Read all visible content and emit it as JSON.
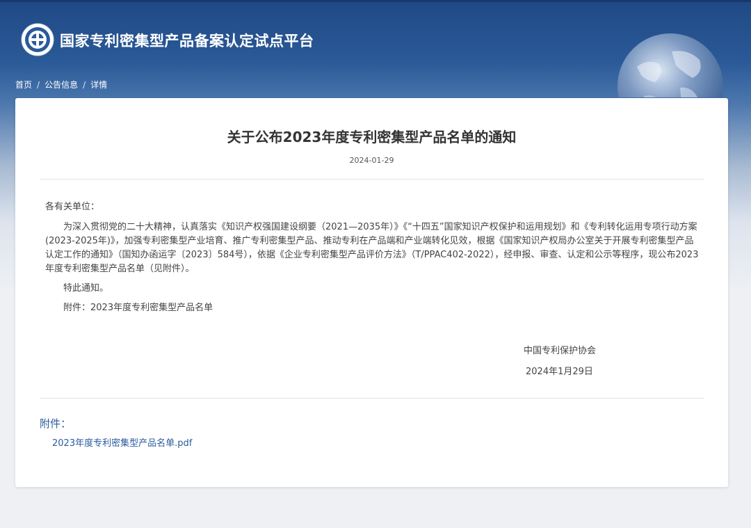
{
  "site": {
    "title": "国家专利密集型产品备案认定试点平台"
  },
  "breadcrumb": [
    {
      "label": "首页"
    },
    {
      "label": "公告信息"
    },
    {
      "label": "详情"
    }
  ],
  "breadcrumb_separator": "/",
  "article": {
    "title": "关于公布2023年度专利密集型产品名单的通知",
    "date": "2024-01-29",
    "greeting": "各有关单位：",
    "paragraphs": [
      "为深入贯彻党的二十大精神，认真落实《知识产权强国建设纲要（2021—2035年）》《“十四五”国家知识产权保护和运用规划》和《专利转化运用专项行动方案(2023-2025年)》，加强专利密集型产业培育、推广专利密集型产品、推动专利在产品端和产业端转化见效，根据《国家知识产权局办公室关于开展专利密集型产品认定工作的通知》（国知办函运字〔2023〕584号），依据《企业专利密集型产品评价方法》（T/PPAC402-2022），经申报、审查、认定和公示等程序，现公布2023年度专利密集型产品名单（见附件）。",
      "特此通知。",
      "附件：2023年度专利密集型产品名单"
    ],
    "signature": {
      "org": "中国专利保护协会",
      "date": "2024年1月29日"
    }
  },
  "attachments": {
    "label": "附件：",
    "files": [
      {
        "name": "2023年度专利密集型产品名单.pdf"
      }
    ]
  },
  "colors": {
    "header_blue": "#1f4985",
    "link_blue": "#2a5b9c",
    "text": "#444444"
  },
  "icons": {
    "logo": "cnipa-logo-emblem",
    "decoration": "globe-image"
  }
}
